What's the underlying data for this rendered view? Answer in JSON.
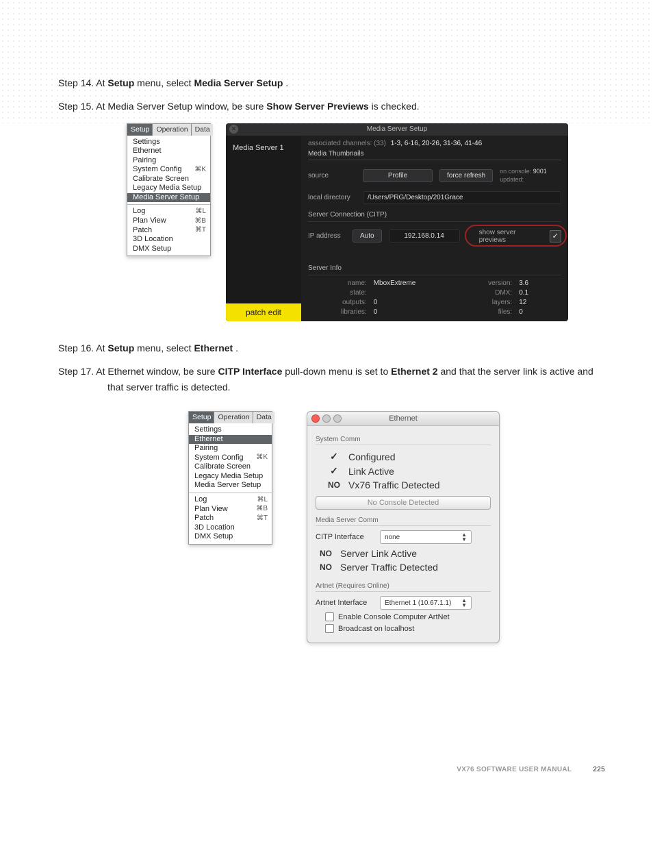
{
  "steps": {
    "s14": {
      "pre": "Step 14.  At ",
      "b1": "Setup",
      "mid": " menu, select ",
      "b2": "Media Server Setup",
      "post": "."
    },
    "s15": {
      "pre": "Step 15.  At Media Server Setup window, be sure ",
      "b1": "Show Server Previews",
      "post": " is checked."
    },
    "s16": {
      "pre": "Step 16.  At ",
      "b1": "Setup",
      "mid": " menu, select ",
      "b2": "Ethernet",
      "post": "."
    },
    "s17": {
      "pre": "Step 17.  At Ethernet window, be sure ",
      "b1": "CITP Interface",
      "mid": " pull-down menu is set to ",
      "b2": "Ethernet 2",
      "post": " and that the server link is active and that server traffic is detected."
    }
  },
  "menu": {
    "tabs": [
      "Setup",
      "Operation",
      "Data"
    ],
    "s1": [
      {
        "label": "Settings"
      },
      {
        "label": "Ethernet"
      },
      {
        "label": "Pairing"
      },
      {
        "label": "System Config",
        "sc": "⌘K"
      },
      {
        "label": "Calibrate Screen"
      },
      {
        "label": "Legacy Media Setup"
      },
      {
        "label": "Media Server Setup",
        "hl": true
      }
    ],
    "s2": [
      {
        "label": "Log",
        "sc": "⌘L"
      },
      {
        "label": "Plan View",
        "sc": "⌘B"
      },
      {
        "label": "Patch",
        "sc": "⌘T"
      },
      {
        "label": "3D Location"
      },
      {
        "label": "DMX Setup"
      }
    ],
    "b_s1": [
      {
        "label": "Settings"
      },
      {
        "label": "Ethernet",
        "hl": true
      },
      {
        "label": "Pairing"
      },
      {
        "label": "System Config",
        "sc": "⌘K"
      },
      {
        "label": "Calibrate Screen"
      },
      {
        "label": "Legacy Media Setup"
      },
      {
        "label": "Media Server Setup"
      }
    ],
    "b_s2": [
      {
        "label": "Log",
        "sc": "⌘L"
      },
      {
        "label": "Plan View",
        "sc": "⌘B"
      },
      {
        "label": "Patch",
        "sc": "⌘T"
      },
      {
        "label": "3D Location"
      },
      {
        "label": "DMX Setup"
      }
    ]
  },
  "mss": {
    "title": "Media Server Setup",
    "close_glyph": "✕",
    "side_item": "Media Server 1",
    "patch_edit": "patch edit",
    "assoc_lbl": "associated channels: (33)",
    "assoc_val": "1-3, 6-16, 20-26, 31-36, 41-46",
    "subtab": "Media Thumbnails",
    "source_lbl": "source",
    "profile_btn": "Profile",
    "refresh_btn": "force refresh",
    "on_console_lbl": "on console:",
    "on_console_val": "9001",
    "updated_lbl": "updated:",
    "localdir_lbl": "local directory",
    "localdir_val": "/Users/PRG/Desktop/201Grace",
    "citp_section": "Server Connection (CITP)",
    "ip_lbl": "IP address",
    "auto_btn": "Auto",
    "ip_val": "192.168.0.14",
    "show_prev_lbl": "show server previews",
    "check_glyph": "✓",
    "info_section": "Server Info",
    "info": {
      "name_k": "name:",
      "name_v": "MboxExtreme",
      "ver_k": "version:",
      "ver_v": "3.6",
      "state_k": "state:",
      "state_v": "",
      "dmx_k": "DMX:",
      "dmx_v": "0.1",
      "out_k": "outputs:",
      "out_v": "0",
      "lay_k": "layers:",
      "lay_v": "12",
      "lib_k": "libraries:",
      "lib_v": "0",
      "fil_k": "files:",
      "fil_v": "0"
    }
  },
  "eth": {
    "title": "Ethernet",
    "sys_sect": "System Comm",
    "configured_mark": "✓",
    "configured": "Configured",
    "linkactive_mark": "✓",
    "linkactive": "Link Active",
    "no_mark": "NO",
    "vx76": "Vx76 Traffic Detected",
    "console_btn": "No Console Detected",
    "msc_sect": "Media Server Comm",
    "citp_lbl": "CITP Interface",
    "citp_val": "none",
    "server_link": "Server Link Active",
    "server_traffic": "Server Traffic Detected",
    "artnet_sect": "Artnet (Requires Online)",
    "artnet_lbl": "Artnet Interface",
    "artnet_val": "Ethernet 1 (10.67.1.1)",
    "cb1": "Enable Console Computer ArtNet",
    "cb2": "Broadcast on localhost"
  },
  "footer": {
    "title": "VX76 SOFTWARE USER MANUAL",
    "page": "225"
  }
}
